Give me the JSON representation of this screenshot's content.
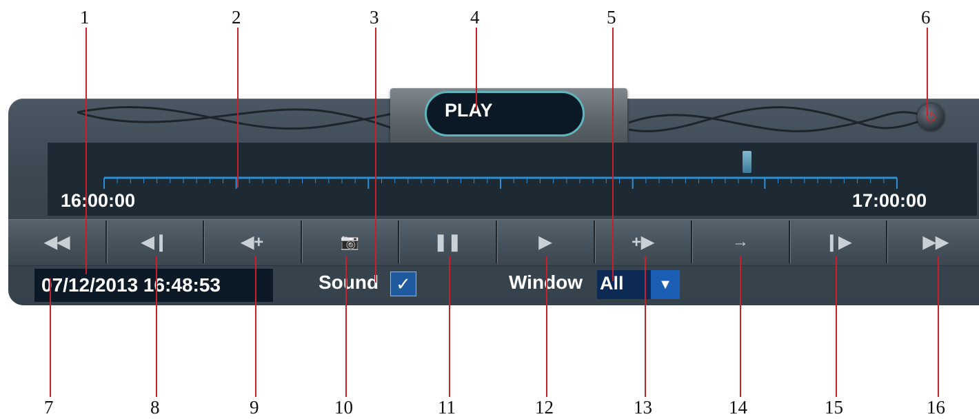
{
  "callouts": {
    "top": [
      "1",
      "2",
      "3",
      "4",
      "5",
      "6"
    ],
    "bottom": [
      "7",
      "8",
      "9",
      "10",
      "11",
      "12",
      "13",
      "14",
      "15",
      "16"
    ]
  },
  "header": {
    "mode_label": "PLAY"
  },
  "timeline": {
    "start_time": "16:00:00",
    "end_time": "17:00:00",
    "playhead_position": 0.81
  },
  "controls": [
    {
      "name": "fast-rewind-button",
      "icon": "fast-rewind-icon",
      "glyph": "◀◀"
    },
    {
      "name": "step-back-button",
      "icon": "step-back-icon",
      "glyph": "◀❙"
    },
    {
      "name": "slow-back-button",
      "icon": "slow-back-icon",
      "glyph": "◀+"
    },
    {
      "name": "snapshot-button",
      "icon": "camera-icon",
      "glyph": "📷"
    },
    {
      "name": "pause-button",
      "icon": "pause-icon",
      "glyph": "❚❚"
    },
    {
      "name": "play-button",
      "icon": "play-icon",
      "glyph": "▶"
    },
    {
      "name": "slow-forward-button",
      "icon": "slow-forward-icon",
      "glyph": "+▶"
    },
    {
      "name": "next-button",
      "icon": "arrow-right-icon",
      "glyph": "→"
    },
    {
      "name": "step-forward-button",
      "icon": "step-forward-icon",
      "glyph": "❙▶"
    },
    {
      "name": "fast-forward-button",
      "icon": "fast-forward-icon",
      "glyph": "▶▶"
    }
  ],
  "status": {
    "datetime": "07/12/2013 16:48:53",
    "sound_label": "Sound",
    "sound_checked": true,
    "sound_check_glyph": "✓",
    "window_label": "Window",
    "window_value": "All",
    "window_arrow_glyph": "▼"
  },
  "colors": {
    "callout_line": "#c8202a",
    "checkbox_fill": "#1f5a9e",
    "timeline_blue": "#2a8fd6",
    "power_red": "#e02020"
  }
}
